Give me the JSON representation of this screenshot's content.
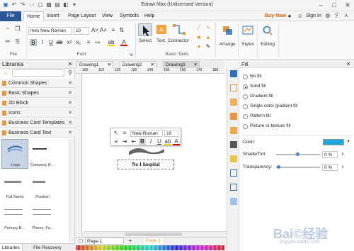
{
  "window": {
    "title": "Edraw Max (Unlicensed Version)"
  },
  "menus": {
    "file": "File",
    "home": "Home",
    "insert": "Insert",
    "page_layout": "Page Layout",
    "view": "View",
    "symbols": "Symbols",
    "help": "Help",
    "buy_now": "Buy Now",
    "sign_in": "Sign In"
  },
  "ribbon": {
    "font_name": "mes New Roman",
    "font_size": "10",
    "groups": {
      "file": "File",
      "font": "Font",
      "basic_tools": "Basic Tools"
    },
    "select_label": "Select",
    "text_label": "Text",
    "connector_label": "Connector",
    "arrange_label": "Arrange",
    "styles_label": "Styles",
    "editing_label": "Editing"
  },
  "libraries": {
    "title": "Libraries",
    "categories": [
      "Common Shapes",
      "Basic Shapes",
      "2D Block",
      "Icons",
      "Business Card Templates",
      "Business Card Text"
    ],
    "thumbs": [
      "Logo",
      "Company N…",
      "Full Name",
      "Position",
      "Primary B…",
      "Phone, Fa…"
    ],
    "tabs": [
      "Libraries",
      "File Recovery"
    ]
  },
  "documents": {
    "tabs": [
      "Drawing1",
      "Drawing2",
      "Drawing3"
    ]
  },
  "ruler": {
    "ticks": [
      "100",
      "110",
      "120",
      "130",
      "140",
      "150",
      "160",
      "170",
      "180"
    ]
  },
  "canvas": {
    "float_font": "New Roman",
    "float_size": "10",
    "hospital_text": "No 1 hospital"
  },
  "pagebar": {
    "page_dropdown": "Page-1",
    "page_tab": "Page-1"
  },
  "fill": {
    "title": "Fill",
    "options": [
      "No fill",
      "Solid fill",
      "Gradient fill",
      "Single color gradient fill",
      "Pattern fill",
      "Picture or texture fill"
    ],
    "selected_index": 1,
    "color_label": "Color:",
    "color_value": "#1fa7e0",
    "shade_label": "Shade/Tint:",
    "shade_value": "0 %",
    "transparency_label": "Transparency:",
    "transparency_value": "0 %"
  },
  "watermark": {
    "brand": "Bai©经验",
    "url": "jingyan.baidu.com"
  },
  "colors": {
    "file_tab": "#2b5797",
    "buy_now": "#e05a00",
    "accent": "#e8973c"
  }
}
